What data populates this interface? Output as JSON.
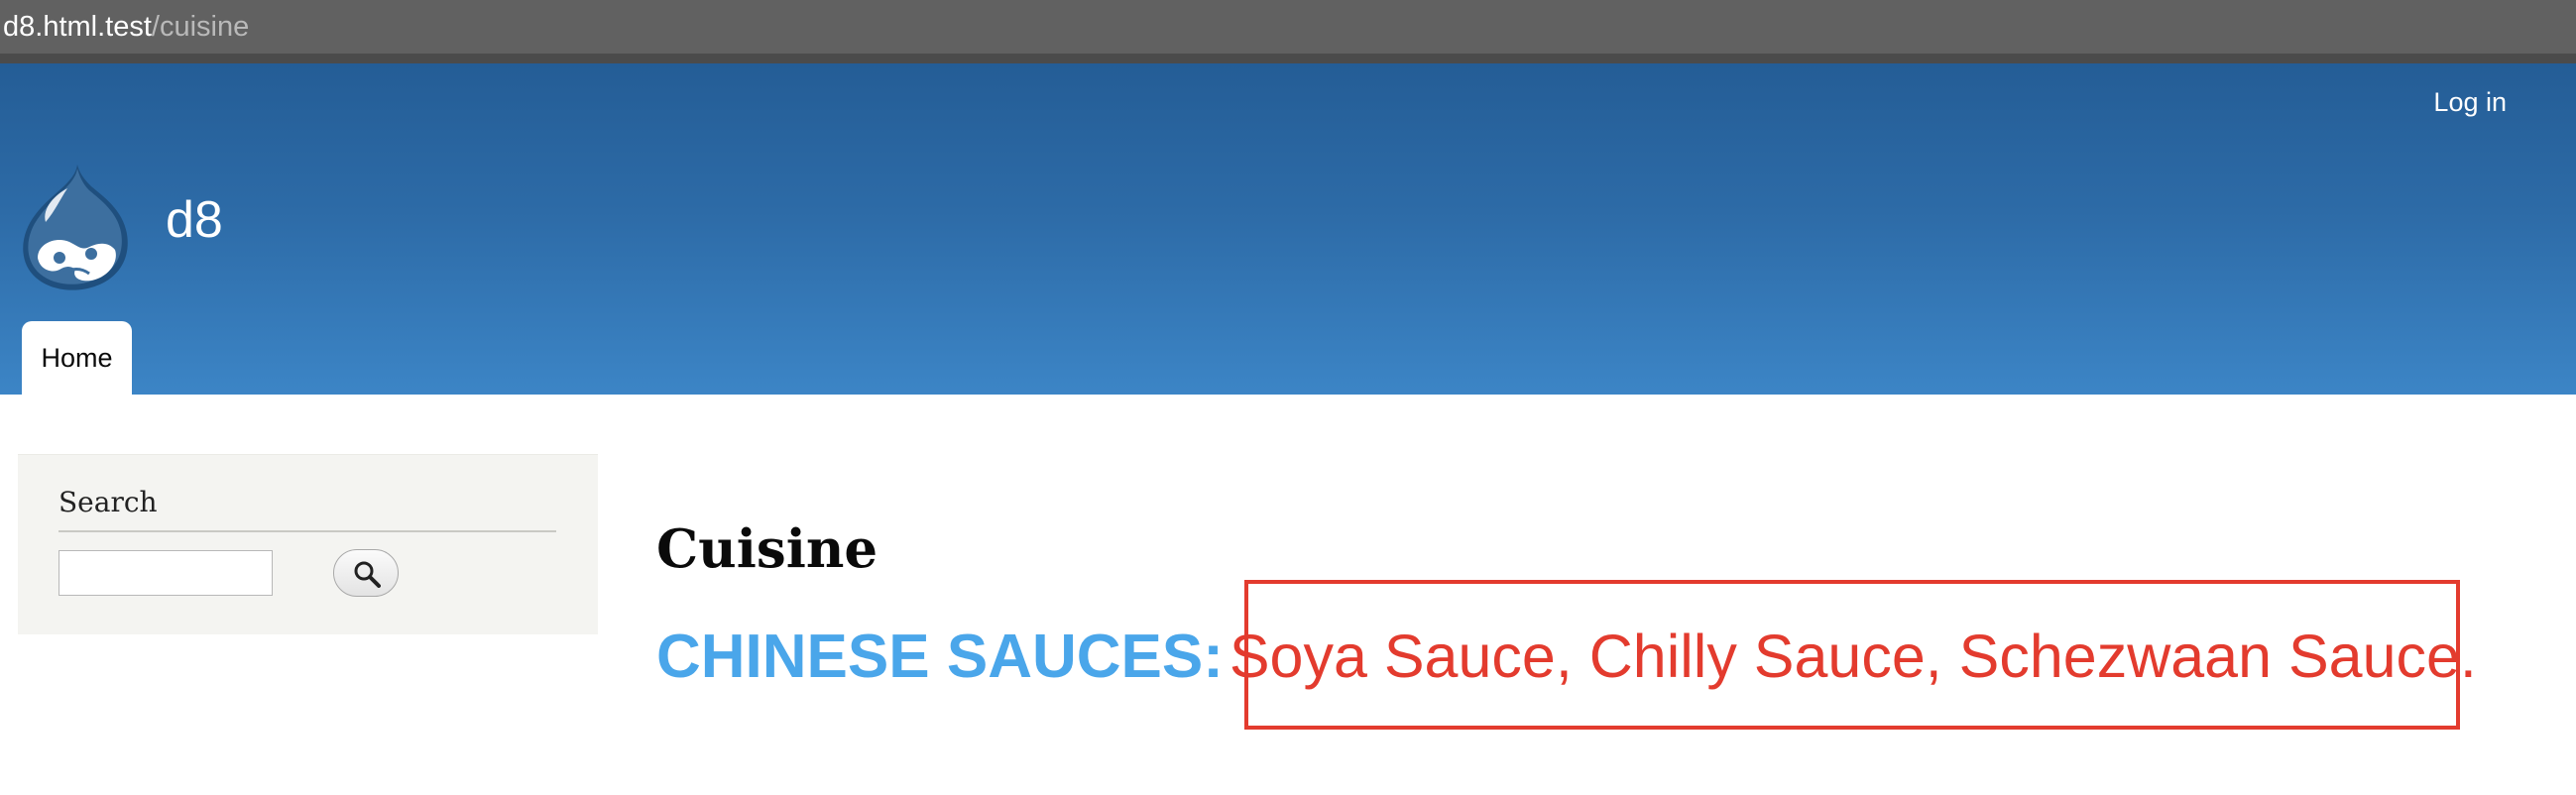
{
  "browser": {
    "url_domain": "d8.html.test",
    "url_path": "/cuisine"
  },
  "header": {
    "login_link": "Log in",
    "site_name": "d8",
    "logo_icon": "drupal-drop-icon",
    "nav": {
      "home_tab": "Home"
    }
  },
  "sidebar": {
    "search_block": {
      "title": "Search",
      "input_value": "",
      "button_icon": "search-icon"
    }
  },
  "main": {
    "page_title": "Cuisine",
    "content": {
      "label": "CHINESE SAUCES:",
      "items_text": "Soya Sauce, Chilly Sauce, Schezwaan Sauce."
    }
  },
  "colors": {
    "header_top": "#245d96",
    "header_bottom": "#3c85c6",
    "label_color": "#4aa6ea",
    "items_color": "#e33b2e",
    "highlight_border": "#e33b2e"
  }
}
